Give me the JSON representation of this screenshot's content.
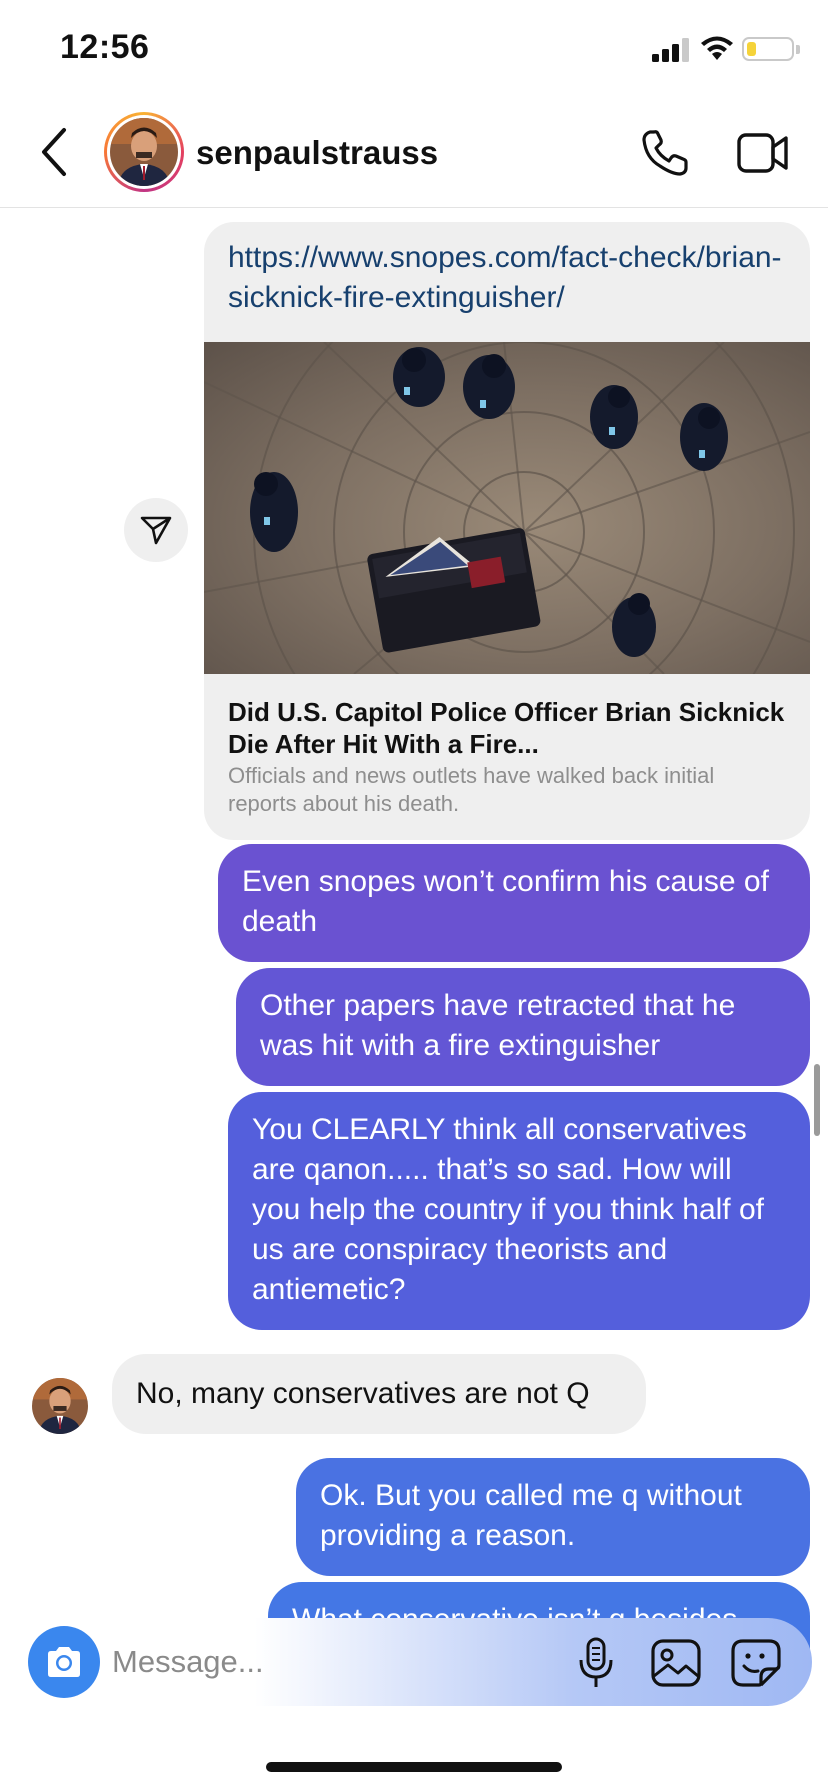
{
  "status_bar": {
    "time": "12:56",
    "battery_level": 0.2
  },
  "header": {
    "username": "senpaulstrauss",
    "icons": [
      "back-icon",
      "avatar",
      "phone-icon",
      "video-icon"
    ]
  },
  "link_card": {
    "url": "https://www.snopes.com/fact-check/brian-sicknick-fire-extinguisher/",
    "title": "Did U.S. Capitol Police Officer Brian Sicknick Die After Hit With a Fire...",
    "description": "Officials and news outlets have walked back initial reports about his death."
  },
  "messages": [
    {
      "direction": "sent",
      "text": "Even snopes won’t confirm his cause of death"
    },
    {
      "direction": "sent",
      "text": "Other papers have retracted that he was hit with a fire extinguisher"
    },
    {
      "direction": "sent",
      "text": "You CLEARLY think all conservatives are qanon..... that’s so sad. How will you help the country if you think half of us are conspiracy theorists and antiemetic?"
    },
    {
      "direction": "received",
      "text": "No, many conservatives are not Q"
    },
    {
      "direction": "sent",
      "text": "Ok. But you called me q without providing a reason."
    },
    {
      "direction": "sent",
      "text": "What conservative isn’t q besides"
    }
  ],
  "composer": {
    "placeholder": "Message...",
    "icons": [
      "camera-icon",
      "mic-icon",
      "gallery-icon",
      "sticker-icon"
    ]
  },
  "colors": {
    "sent_bubble_top": "#6a52d1",
    "sent_bubble_bottom": "#4477e5",
    "received_bubble": "#efefef",
    "link_text": "#17406e",
    "camera_button": "#3a87ee"
  }
}
